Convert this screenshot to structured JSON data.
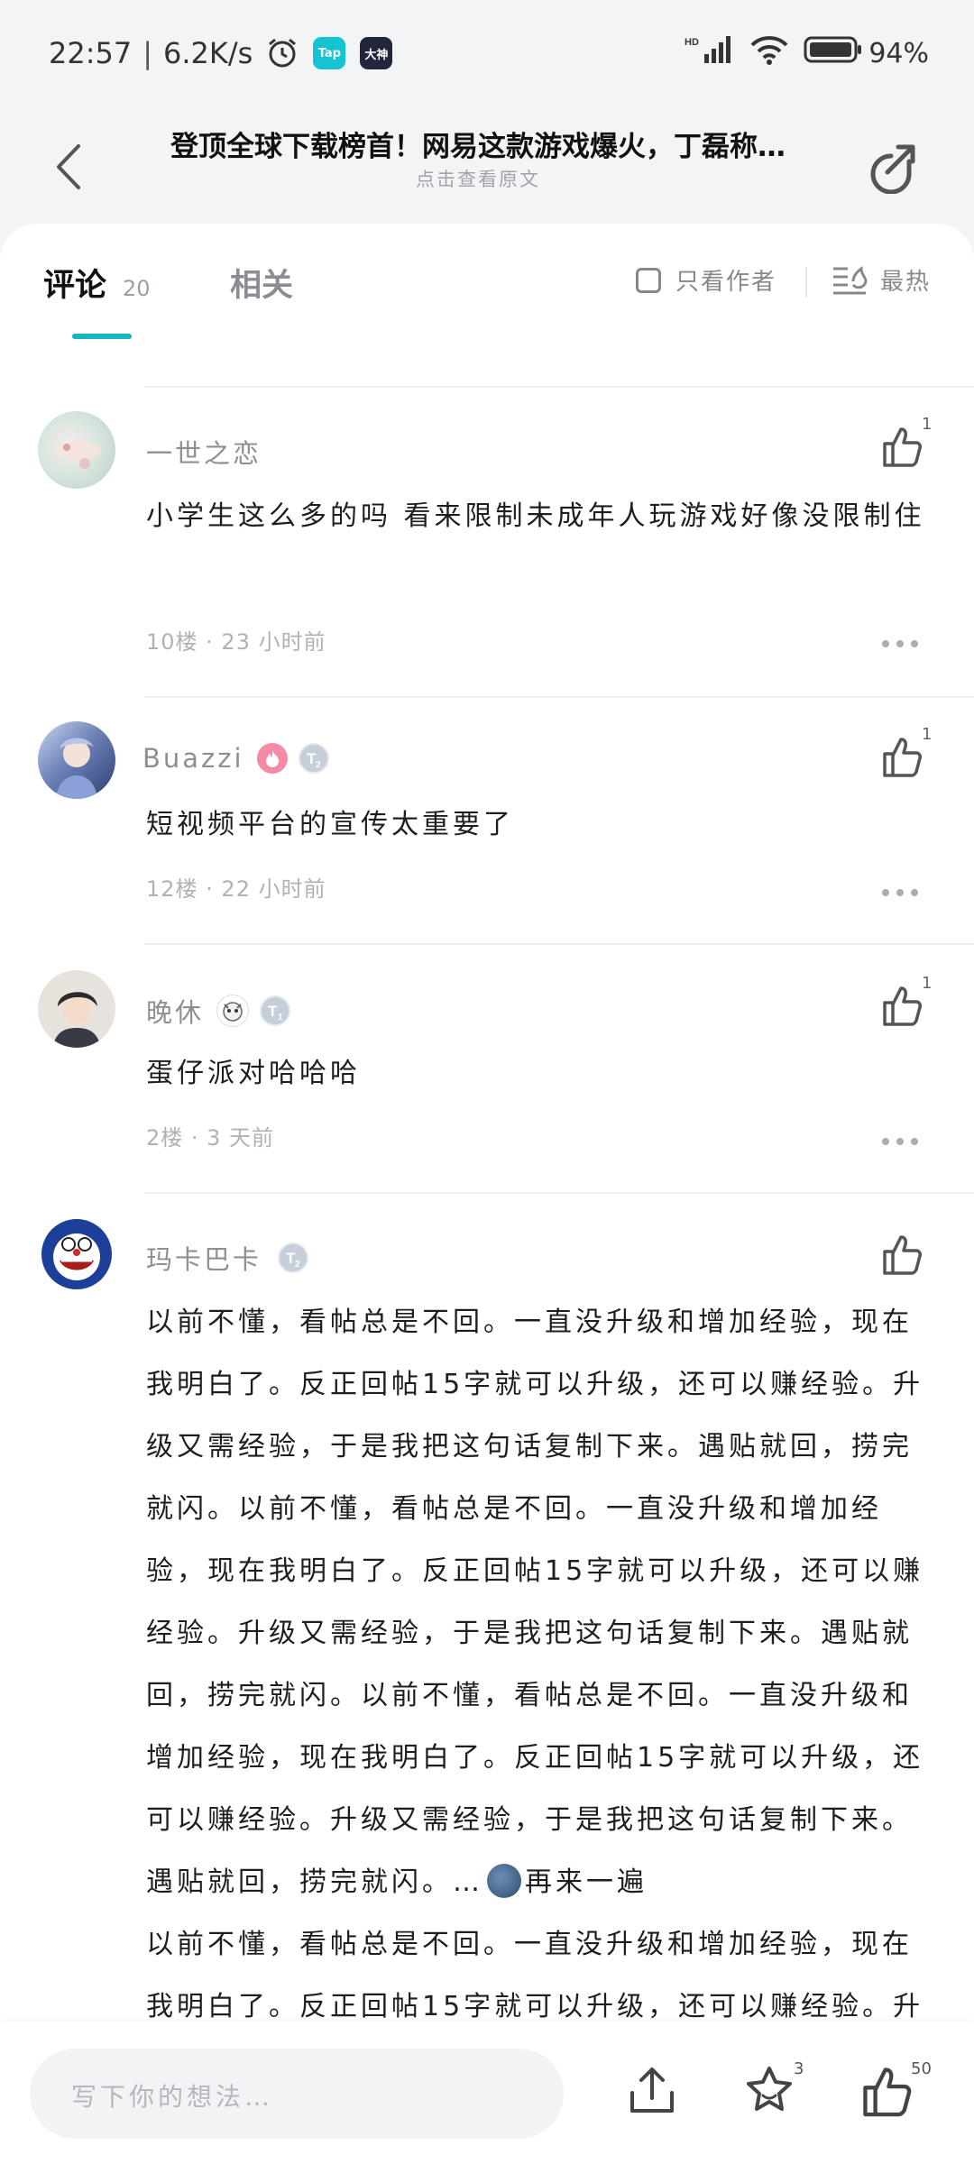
{
  "status_bar": {
    "time": "22:57",
    "net_speed": "6.2K/s",
    "battery": "94%",
    "app_icons": [
      "Tap",
      "大神"
    ]
  },
  "header": {
    "title": "登顶全球下载榜首！网易这款游戏爆火，丁磊称…",
    "subtitle": "点击查看原文"
  },
  "tabs": {
    "comment_label": "评论",
    "comment_count": "20",
    "related_label": "相关",
    "author_only": "只看作者",
    "sort_label": "最热",
    "accent": "#17b6c0"
  },
  "comments": [
    {
      "name": "一世之恋",
      "text": "小学生这么多的吗 看来限制未成年人玩游戏好像没限制住",
      "meta": "10楼 · 23 小时前",
      "likes": "1"
    },
    {
      "name": "Buazzi",
      "badge_level": "2",
      "text": "短视频平台的宣传太重要了",
      "meta": "12楼 · 22 小时前",
      "likes": "1"
    },
    {
      "name": "晚休",
      "badge_level": "1",
      "text": "蛋仔派对哈哈哈",
      "meta": "2楼 · 3 天前",
      "likes": "1"
    },
    {
      "name": "玛卡巴卡",
      "badge_level": "2",
      "text": "以前不懂，看帖总是不回。一直没升级和增加经验，现在我明白了。反正回帖15字就可以升级，还可以赚经验。升级又需经验，于是我把这句话复制下来。遇贴就回，捞完就闪。以前不懂，看帖总是不回。一直没升级和增加经验，现在我明白了。反正回帖15字就可以升级，还可以赚经验。升级又需经验，于是我把这句话复制下来。遇贴就回，捞完就闪。以前不懂，看帖总是不回。一直没升级和增加经验，现在我明白了。反正回帖15字就可以升级，还可以赚经验。升级又需经验，于是我把这句话复制下来。遇贴就回，捞完就闪。…",
      "text_tail": "再来一遍",
      "text2": "以前不懂，看帖总是不回。一直没升级和增加经验，现在我明白了。反正回帖15字就可以升级，还可以赚经验。升"
    }
  ],
  "bottom_bar": {
    "input_placeholder": "写下你的想法…",
    "star_count": "3",
    "like_count": "50"
  }
}
